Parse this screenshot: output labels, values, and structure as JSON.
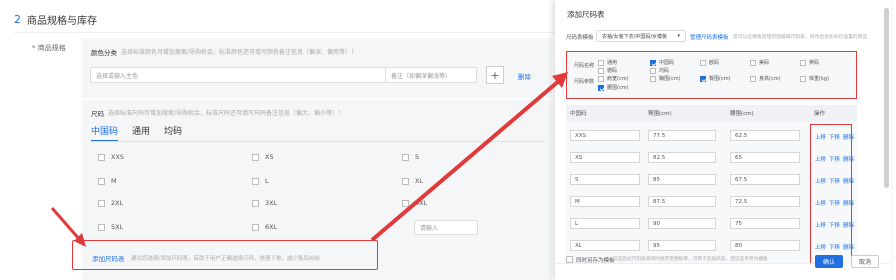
{
  "left": {
    "section_num": "2",
    "section_title": "商品规格与库存",
    "spec_label": "* 商品规格",
    "color": {
      "title": "颜色分类",
      "hint": "选择标准颜色可增加搜索/导购机会，标准颜色还可填写颜色备注信息（偏深、偏亮等）！",
      "select_placeholder": "选择或输入主色",
      "note_placeholder": "备注（如偏深偏浅等）",
      "add_symbol": "+",
      "delete_label": "删除"
    },
    "size": {
      "title": "尺码",
      "hint": "选择标准尺码可增加搜索/导购机会，标准尺码还可填写尺码备注信息（偏大、偏小等）！",
      "tabs": [
        "中国码",
        "通用",
        "均码"
      ],
      "options": [
        [
          "XXS",
          "XS",
          "S"
        ],
        [
          "M",
          "L",
          "XL"
        ],
        [
          "2XL",
          "3XL",
          "4XL"
        ],
        [
          "5XL",
          "6XL",
          ""
        ]
      ],
      "custom_placeholder": "请输入"
    },
    "add_chart_link": "添加尺码表",
    "add_chart_hint": "建议您选择/添加尺码表，有助于用户正确选择尺码，快速下单，减少售后纠纷"
  },
  "modal": {
    "title": "添加尺码表",
    "template_label": "尺码表模板",
    "template_value": "衣袖/女装下衣/中国码/女模板",
    "manage_link": "管理尺码表模板",
    "manage_hint": "您可以在模板管理页面编辑尺码表，修改后会影响已设置的商品",
    "params": {
      "row1_label": "尺码名称",
      "row2_label": "尺码参数",
      "items": [
        {
          "label": "通用",
          "checked": false
        },
        {
          "label": "中国码",
          "checked": true
        },
        {
          "label": "欧码",
          "checked": false
        },
        {
          "label": "美码",
          "checked": false
        },
        {
          "label": "英码",
          "checked": false
        },
        {
          "label": "德码",
          "checked": false
        },
        {
          "label": "均码",
          "checked": false
        },
        {
          "label": "肩宽(cm)",
          "checked": false
        },
        {
          "label": "胸围(cm)",
          "checked": false
        },
        {
          "label": "臀围(cm)",
          "checked": true
        },
        {
          "label": "身高(cm)",
          "checked": false
        },
        {
          "label": "体重(kg)",
          "checked": false
        },
        {
          "label": "腰围(cm)",
          "checked": true
        }
      ]
    },
    "table": {
      "headers": [
        "中国码",
        "臀围(cm)",
        "腰围(cm)",
        "操作"
      ],
      "rows": [
        [
          "XXS",
          "77.5",
          "62.5"
        ],
        [
          "XS",
          "82.5",
          "65"
        ],
        [
          "S",
          "85",
          "67.5"
        ],
        [
          "M",
          "87.5",
          "72.5"
        ],
        [
          "L",
          "90",
          "75"
        ],
        [
          "XL",
          "95",
          "80"
        ]
      ],
      "ops": [
        "上移",
        "下移",
        "删除"
      ]
    },
    "save_template": "同时另存为模板",
    "save_hint": "勾选后此尺码表将同时保存至模板库，可用于后续商品，建议您另存为模板",
    "confirm": "确认",
    "cancel": "取消",
    "accent": "#1f6fe0",
    "highlight": "#e23a3a"
  }
}
